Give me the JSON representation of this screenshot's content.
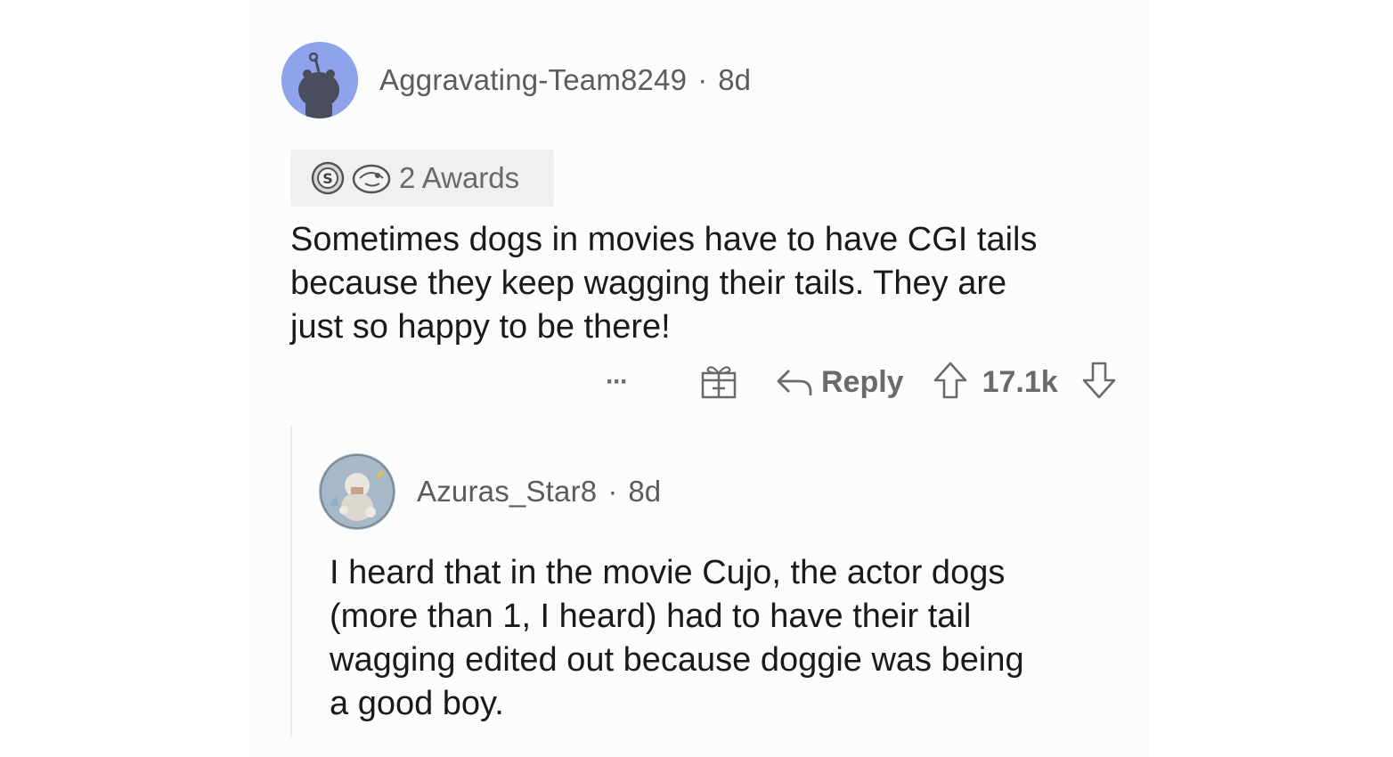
{
  "comment": {
    "username": "Aggravating-Team8249",
    "age": "8d",
    "separator": "·",
    "awards_label": "2 Awards",
    "award_icons": [
      "silver-award-icon",
      "helpful-award-icon"
    ],
    "lines": [
      "Sometimes dogs in movies have to have CGI tails",
      "because they keep wagging their tails. They are",
      "just so happy to be there!"
    ],
    "actions": {
      "more": "···",
      "reply": "Reply",
      "score": "17.1k"
    }
  },
  "reply": {
    "username": "Azuras_Star8",
    "age": "8d",
    "separator": "·",
    "lines": [
      "I heard that in the movie Cujo, the actor dogs",
      "(more than 1, I heard) had to have their tail",
      "wagging edited out because doggie was being",
      "a good boy."
    ]
  },
  "colors": {
    "avatar_blue": "#8ea3ec",
    "meta_gray": "#5c5c5e",
    "text": "#1a1a1b"
  }
}
